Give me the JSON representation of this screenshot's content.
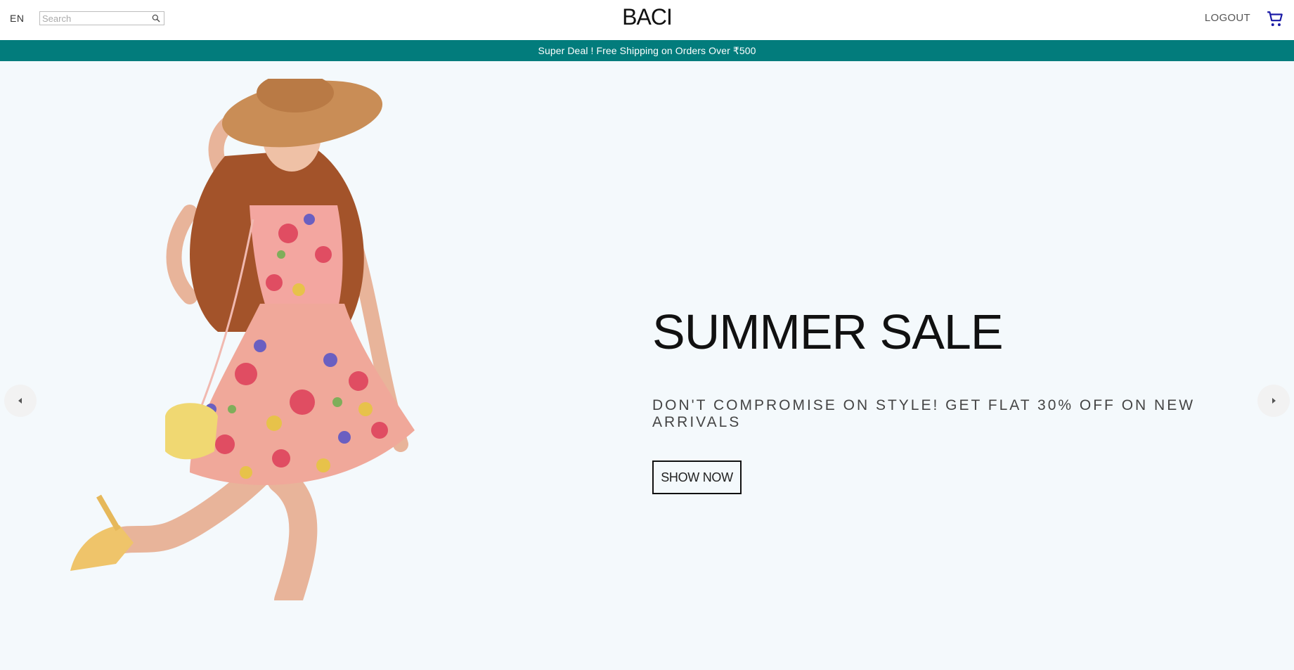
{
  "header": {
    "language": "EN",
    "search_placeholder": "Search",
    "logo": "BACI",
    "logout": "LOGOUT"
  },
  "announcement": "Super Deal ! Free Shipping on Orders Over ₹500",
  "slide": {
    "title": "SUMMER SALE",
    "description": "DON'T COMPROMISE ON STYLE! GET FLAT 30% OFF ON NEW ARRIVALS",
    "button": "SHOW NOW"
  },
  "icons": {
    "search": "search-icon",
    "cart": "shopping-cart-icon",
    "prev": "arrow-left-icon",
    "next": "arrow-right-icon"
  },
  "colors": {
    "announcement_bg": "#027c7c",
    "slide_bg": "#f4f9fc",
    "cart_icon": "#1a1aa6"
  }
}
